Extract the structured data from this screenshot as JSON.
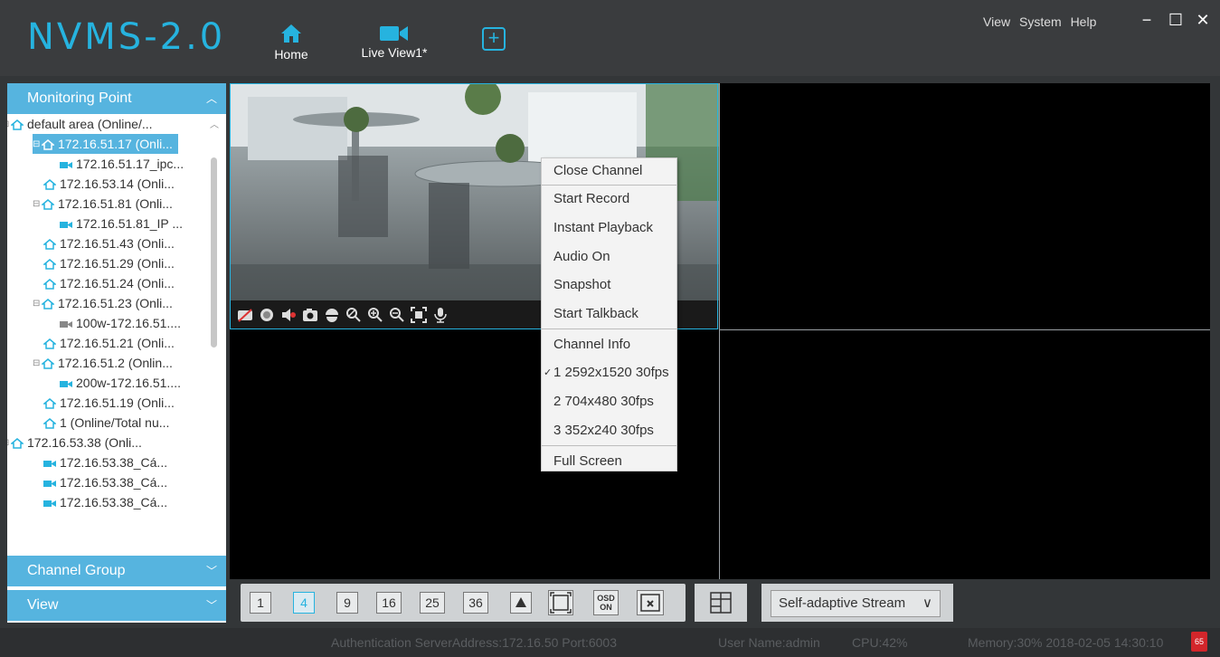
{
  "app": {
    "title": "NVMS-2.0"
  },
  "nav": {
    "home_label": "Home",
    "liveview_label": "Live View1*",
    "add_tab_symbol": "+"
  },
  "topmenu": {
    "view": "View",
    "system": "System",
    "help": "Help"
  },
  "window_controls": {
    "minimize": "−",
    "maximize": "☐",
    "close": "✕"
  },
  "sidebar": {
    "monitoring_point": "Monitoring Point",
    "channel_group": "Channel Group",
    "view": "View",
    "tree": [
      {
        "label": "default area (Online/...",
        "icon": "home-icon",
        "expander": "⊟",
        "level": 0
      },
      {
        "label": "172.16.51.17 (Onli...",
        "icon": "home-icon",
        "expander": "⊟",
        "level": 1,
        "selected": true
      },
      {
        "label": "172.16.51.17_ipc...",
        "icon": "camera-icon",
        "expander": "",
        "level": 2
      },
      {
        "label": "172.16.53.14 (Onli...",
        "icon": "home-icon",
        "expander": "",
        "level": 1
      },
      {
        "label": "172.16.51.81 (Onli...",
        "icon": "home-icon",
        "expander": "⊟",
        "level": 1
      },
      {
        "label": "172.16.51.81_IP ...",
        "icon": "camera-icon",
        "expander": "",
        "level": 2
      },
      {
        "label": "172.16.51.43 (Onli...",
        "icon": "home-icon",
        "expander": "",
        "level": 1
      },
      {
        "label": "172.16.51.29 (Onli...",
        "icon": "home-icon",
        "expander": "",
        "level": 1
      },
      {
        "label": "172.16.51.24 (Onli...",
        "icon": "home-icon",
        "expander": "",
        "level": 1
      },
      {
        "label": "172.16.51.23 (Onli...",
        "icon": "home-icon",
        "expander": "⊟",
        "level": 1
      },
      {
        "label": "100w-172.16.51....",
        "icon": "camera-offline-icon",
        "expander": "",
        "level": 2
      },
      {
        "label": "172.16.51.21 (Onli...",
        "icon": "home-icon",
        "expander": "",
        "level": 1
      },
      {
        "label": "172.16.51.2 (Onlin...",
        "icon": "home-icon",
        "expander": "⊟",
        "level": 1
      },
      {
        "label": "200w-172.16.51....",
        "icon": "camera-icon",
        "expander": "",
        "level": 2
      },
      {
        "label": "172.16.51.19 (Onli...",
        "icon": "home-icon",
        "expander": "",
        "level": 1
      },
      {
        "label": "1 (Online/Total nu...",
        "icon": "home-icon",
        "expander": "",
        "level": 1
      },
      {
        "label": "172.16.53.38 (Onli...",
        "icon": "home-icon",
        "expander": "⊟",
        "level": 0
      },
      {
        "label": "172.16.53.38_Cá...",
        "icon": "camera-icon",
        "expander": "",
        "level": 1
      },
      {
        "label": "172.16.53.38_Cá...",
        "icon": "camera-icon",
        "expander": "",
        "level": 1
      },
      {
        "label": "172.16.53.38_Cá...",
        "icon": "camera-icon",
        "expander": "",
        "level": 1
      }
    ]
  },
  "context_menu": {
    "close_channel": "Close Channel",
    "start_record": "Start Record",
    "instant_playback": "Instant Playback",
    "audio_on": "Audio On",
    "snapshot": "Snapshot",
    "start_talkback": "Start Talkback",
    "channel_info": "Channel Info",
    "stream1": "1 2592x1520 30fps",
    "stream2": "2 704x480 30fps",
    "stream3": "3 352x240 30fps",
    "full_screen": "Full Screen",
    "checkmark": "✓"
  },
  "layout_buttons": {
    "one": "1",
    "four": "4",
    "nine": "9",
    "sixteen": "16",
    "twentyfive": "25",
    "thirtysix": "36",
    "osd_line1": "OSD",
    "osd_line2": "ON"
  },
  "stream_select": {
    "value": "Self-adaptive Stream"
  },
  "status": {
    "auth": "Authentication ServerAddress:172.16.50 Port:6003",
    "user": "User Name:admin",
    "cpu": "CPU:42%",
    "memory_time": "Memory:30% 2018-02-05 14:30:10",
    "alarm_count": "65"
  },
  "colors": {
    "accent": "#26b3df",
    "sidebar_head": "#56b4df",
    "alarm": "#d3262b"
  }
}
